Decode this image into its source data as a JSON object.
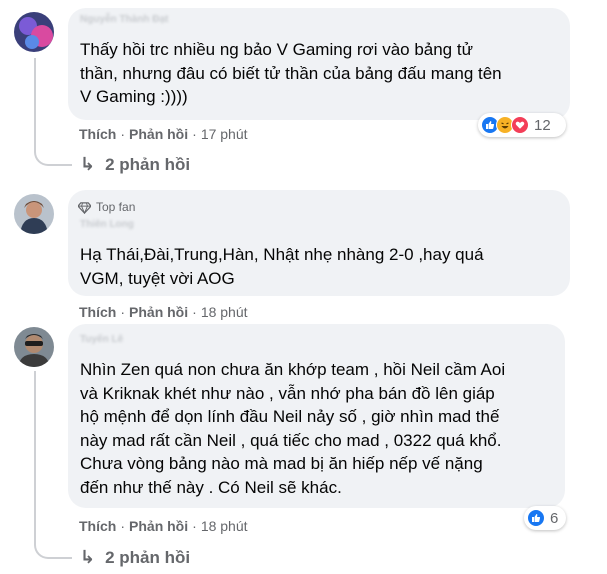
{
  "comments": [
    {
      "author": "Nguyễn Thành Đạt",
      "badge": "",
      "text": "Thấy hồi trc nhiều ng bảo V Gaming rơi vào bảng tử\nthần, nhưng đâu có biết tử thần của bảng đấu mang tên\nV Gaming :))))",
      "like_label": "Thích",
      "reply_label": "Phản hồi",
      "time": "17 phút",
      "reaction_icons": [
        "like-icon",
        "haha-icon",
        "love-icon"
      ],
      "reaction_count": "12",
      "replies_label": "2 phản hồi"
    },
    {
      "author": "Thiên Long",
      "badge": "Top fan",
      "text": "Hạ Thái,Đài,Trung,Hàn, Nhật nhẹ nhàng 2-0 ,hay quá\nVGM, tuyệt vời AOG",
      "like_label": "Thích",
      "reply_label": "Phản hồi",
      "time": "18 phút"
    },
    {
      "author": "Tuyến Lê",
      "badge": "",
      "text": "Nhìn Zen quá non chưa ăn khớp team , hồi Neil cầm Aoi\nvà Kriknak khét như nào , vẫn nhớ pha bán đồ lên giáp\nhộ mệnh để dọn lính đầu Neil nảy số , giờ nhìn mad thế\nnày mad rất cần Neil , quá tiếc cho mad , 0322 quá khổ.\nChưa vòng bảng nào mà mad bị ăn hiếp nếp vế nặng\nđến như thế này . Có Neil sẽ khác.",
      "like_label": "Thích",
      "reply_label": "Phản hồi",
      "time": "18 phút",
      "reaction_icons": [
        "like-icon"
      ],
      "reaction_count": "6",
      "replies_label": "2 phản hồi"
    }
  ],
  "colors": {
    "bubble": "#f0f2f5",
    "secondary_text": "#65676b",
    "like_blue": "#1877f2",
    "love_red": "#f33e58",
    "haha_yellow": "#f7b125"
  }
}
